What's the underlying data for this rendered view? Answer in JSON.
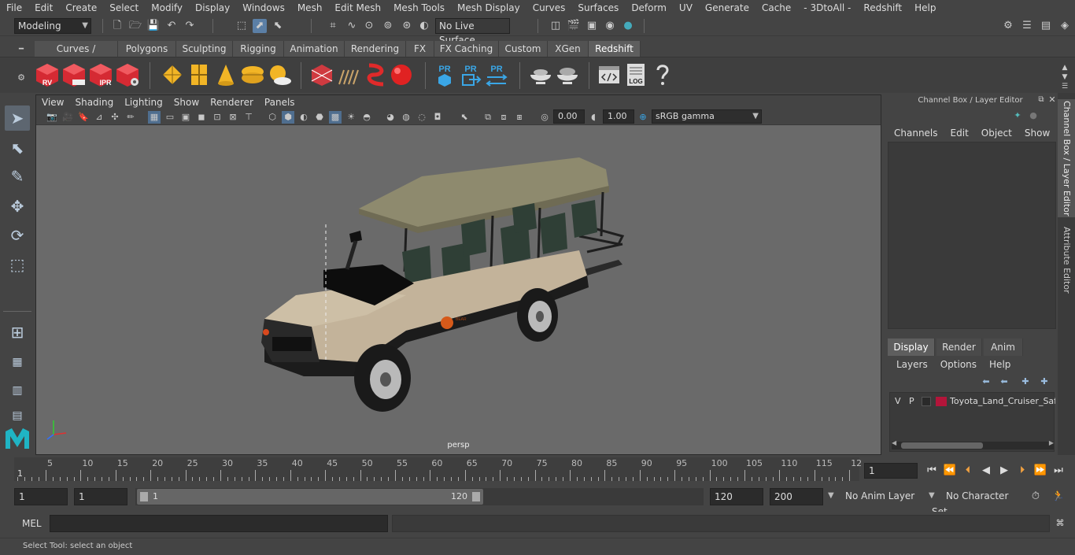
{
  "menubar": {
    "items": [
      "File",
      "Edit",
      "Create",
      "Select",
      "Modify",
      "Display",
      "Windows",
      "Mesh",
      "Edit Mesh",
      "Mesh Tools",
      "Mesh Display",
      "Curves",
      "Surfaces",
      "Deform",
      "UV",
      "Generate",
      "Cache",
      "- 3DtoAll -",
      "Redshift",
      "Help"
    ]
  },
  "statusline": {
    "mode": "Modeling",
    "live_surface": "No Live Surface"
  },
  "shelf": {
    "tabs": [
      "Curves / Surfaces",
      "Polygons",
      "Sculpting",
      "Rigging",
      "Animation",
      "Rendering",
      "FX",
      "FX Caching",
      "Custom",
      "XGen",
      "Redshift"
    ],
    "active_tab": "Redshift",
    "icon_labels": {
      "rv": "RV",
      "ipr": "IPR",
      "pr1": "PR",
      "pr2": "PR",
      "pr3": "PR",
      "log": "LOG"
    }
  },
  "viewport": {
    "menu": [
      "View",
      "Shading",
      "Lighting",
      "Show",
      "Renderer",
      "Panels"
    ],
    "exposure": "0.00",
    "gamma": "1.00",
    "color_space": "sRGB gamma",
    "camera": "persp"
  },
  "channelbox": {
    "title": "Channel Box / Layer Editor",
    "menu": [
      "Channels",
      "Edit",
      "Object",
      "Show"
    ]
  },
  "layereditor": {
    "tabs": [
      "Display",
      "Render",
      "Anim"
    ],
    "active_tab": "Display",
    "menu": [
      "Layers",
      "Options",
      "Help"
    ],
    "layer": {
      "v": "V",
      "p": "P",
      "name": "Toyota_Land_Cruiser_Safa",
      "color": "#b3153a"
    }
  },
  "side_tabs": [
    "Channel Box / Layer Editor",
    "Attribute Editor"
  ],
  "timeline": {
    "ticks": [
      "5",
      "10",
      "15",
      "20",
      "25",
      "30",
      "35",
      "40",
      "45",
      "50",
      "55",
      "60",
      "65",
      "70",
      "75",
      "80",
      "85",
      "90",
      "95",
      "100",
      "105",
      "110",
      "115",
      "12"
    ],
    "start_label": "1",
    "current_frame": "1"
  },
  "range": {
    "start": "1",
    "playback_start": "1",
    "slider_start": "1",
    "slider_end": "120",
    "playback_end": "120",
    "end": "200",
    "anim_layer": "No Anim Layer",
    "char_set": "No Character Set"
  },
  "cmdline": {
    "label": "MEL"
  },
  "helpline": {
    "text": "Select Tool: select an object"
  }
}
